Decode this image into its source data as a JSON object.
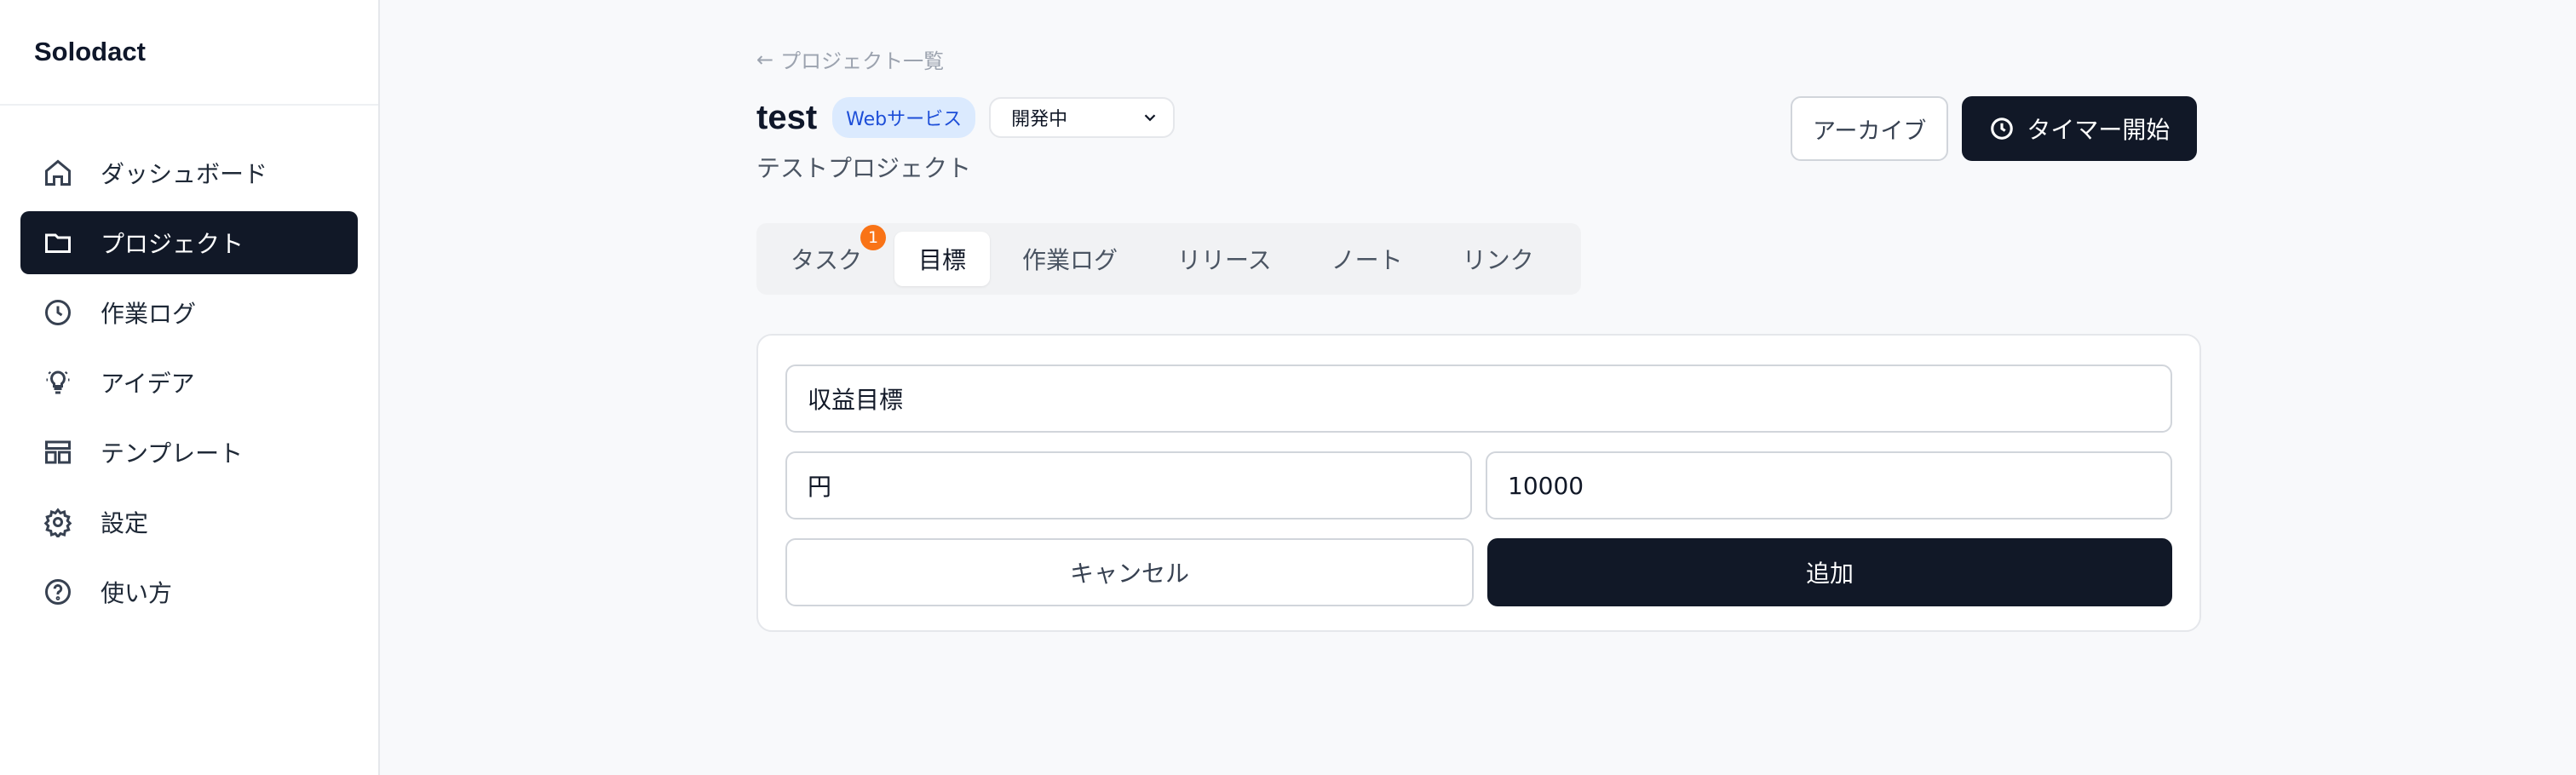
{
  "app": {
    "brand": "Solodact"
  },
  "sidebar": {
    "items": [
      {
        "label": "ダッシュボード",
        "icon": "home-icon",
        "active": false
      },
      {
        "label": "プロジェクト",
        "icon": "folder-icon",
        "active": true
      },
      {
        "label": "作業ログ",
        "icon": "clock-icon",
        "active": false
      },
      {
        "label": "アイデア",
        "icon": "lightbulb-icon",
        "active": false
      },
      {
        "label": "テンプレート",
        "icon": "layout-icon",
        "active": false
      },
      {
        "label": "設定",
        "icon": "gear-icon",
        "active": false
      },
      {
        "label": "使い方",
        "icon": "help-icon",
        "active": false
      }
    ]
  },
  "header": {
    "back_link": "プロジェクト一覧",
    "title": "test",
    "category": "Webサービス",
    "status": "開発中",
    "description": "テストプロジェクト",
    "archive_label": "アーカイブ",
    "timer_label": "タイマー開始"
  },
  "tabs": [
    {
      "label": "タスク",
      "badge": "1",
      "active": false
    },
    {
      "label": "目標",
      "active": true
    },
    {
      "label": "作業ログ",
      "active": false
    },
    {
      "label": "リリース",
      "active": false
    },
    {
      "label": "ノート",
      "active": false
    },
    {
      "label": "リンク",
      "active": false
    }
  ],
  "goal_form": {
    "title_value": "収益目標",
    "unit_value": "円",
    "target_value": "10000",
    "cancel_label": "キャンセル",
    "add_label": "追加"
  },
  "colors": {
    "primary": "#111827",
    "badge": "#f97316",
    "category_bg": "#dbeafe",
    "category_text": "#1d4ed8"
  }
}
